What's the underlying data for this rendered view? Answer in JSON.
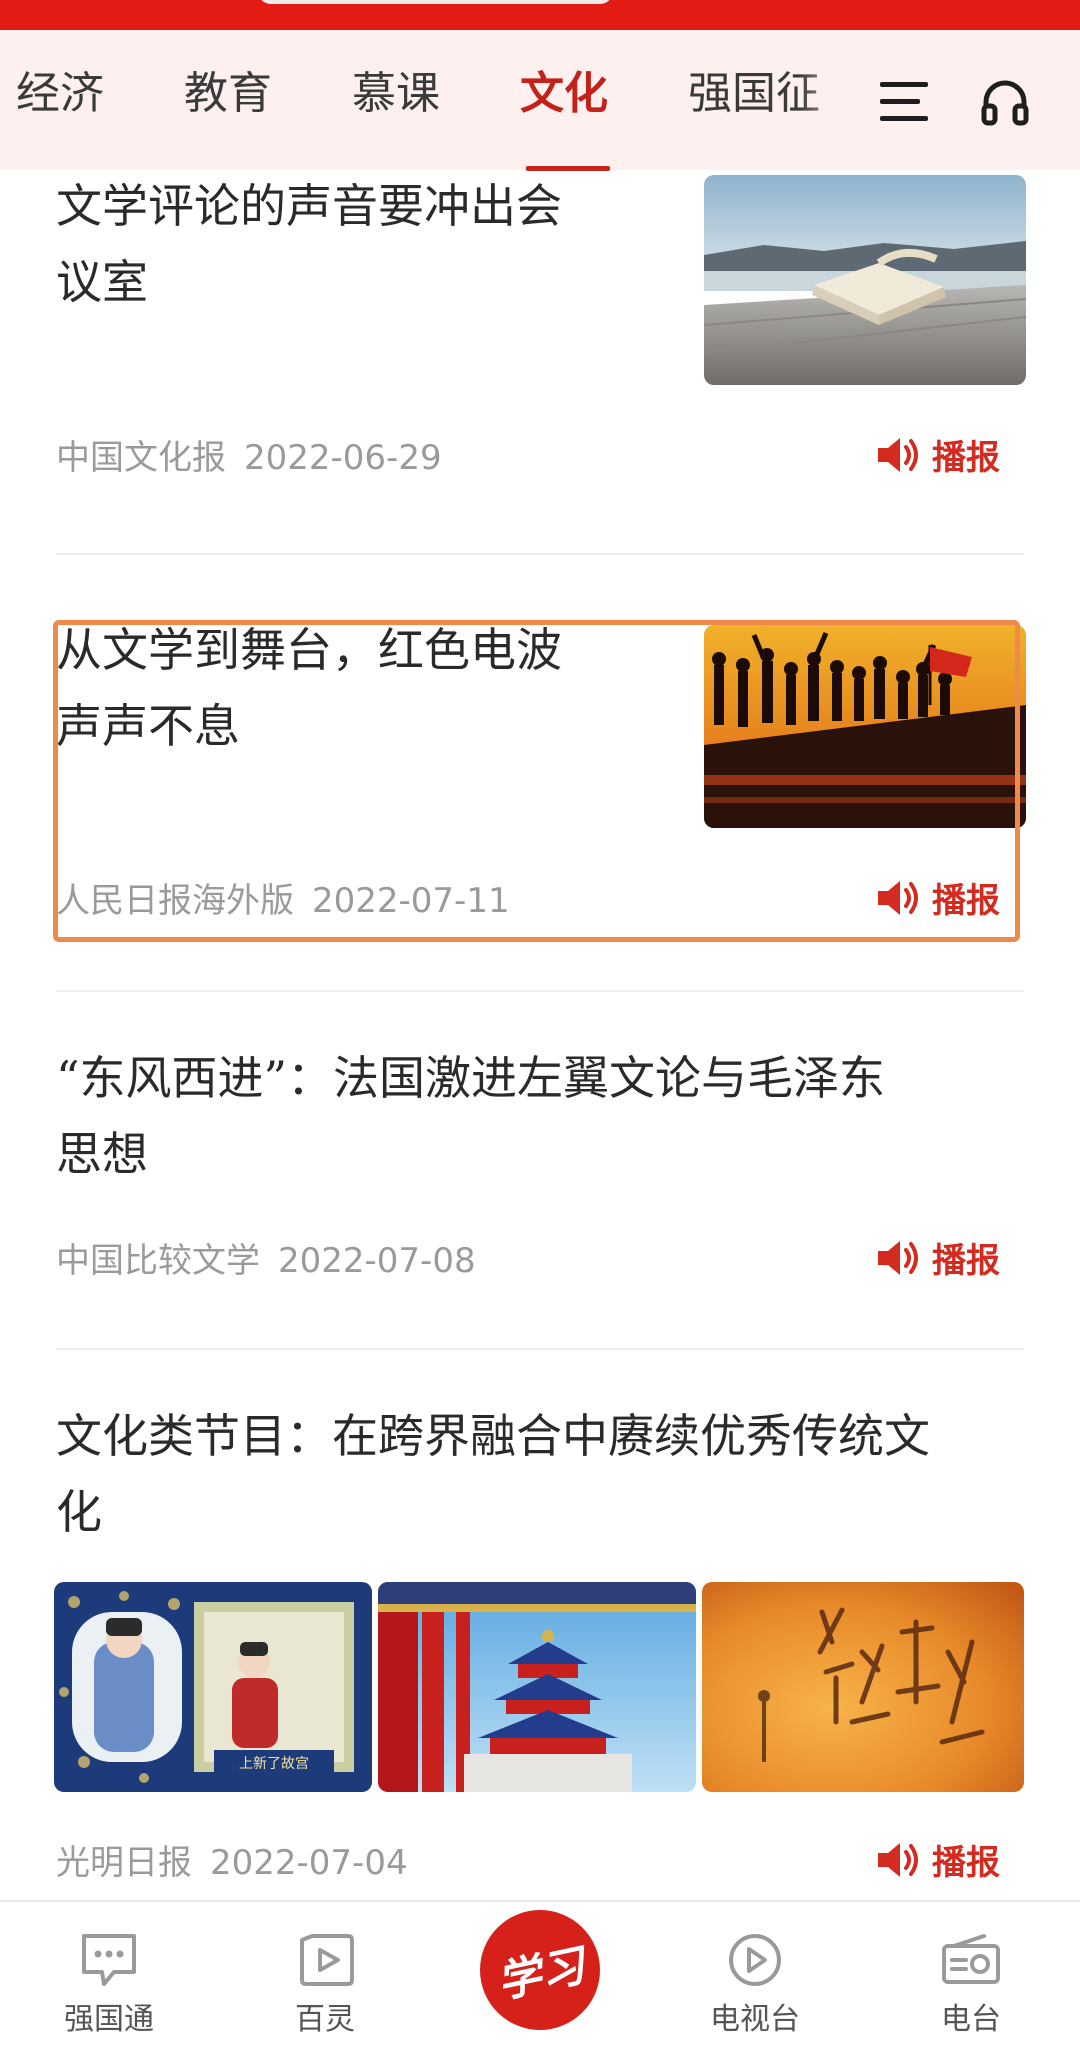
{
  "tabs": {
    "items": [
      {
        "label": "经济"
      },
      {
        "label": "教育"
      },
      {
        "label": "慕课"
      },
      {
        "label": "文化"
      },
      {
        "label": "强国征"
      }
    ],
    "active": "文化"
  },
  "icons": {
    "menu": "menu-icon",
    "headphone": "headphone-icon",
    "speaker": "speaker-icon"
  },
  "articles": [
    {
      "title_lines": [
        "文学评论的声音要冲出会",
        "议室"
      ],
      "source": "中国文化报",
      "date": "2022-06-29",
      "action": "播报"
    },
    {
      "title_lines": [
        "从文学到舞台，红色电波",
        "声声不息"
      ],
      "source": "人民日报海外版",
      "date": "2022-07-11",
      "action": "播报"
    },
    {
      "title_lines": [
        "“东风西进”：法国激进左翼文论与毛泽东",
        "思想"
      ],
      "source": "中国比较文学",
      "date": "2022-07-08",
      "action": "播报"
    },
    {
      "title_lines": [
        "文化类节目：在跨界融合中赓续优秀传统文",
        "化"
      ],
      "source": "光明日报",
      "date": "2022-07-04",
      "action": "播报"
    }
  ],
  "image_text": {
    "palace_caption": "上新了故宫"
  },
  "bottom_nav": {
    "items": [
      {
        "label": "强国通"
      },
      {
        "label": "百灵"
      },
      {
        "label": "电视台"
      },
      {
        "label": "电台"
      }
    ],
    "center_label": "学习"
  },
  "colors": {
    "brand_red": "#e21b14",
    "active_tab": "#c3221a",
    "broadcast_red": "#d32b1f",
    "highlight_border": "#ef8a4a",
    "tab_bar_bg": "#fdf0ee"
  }
}
